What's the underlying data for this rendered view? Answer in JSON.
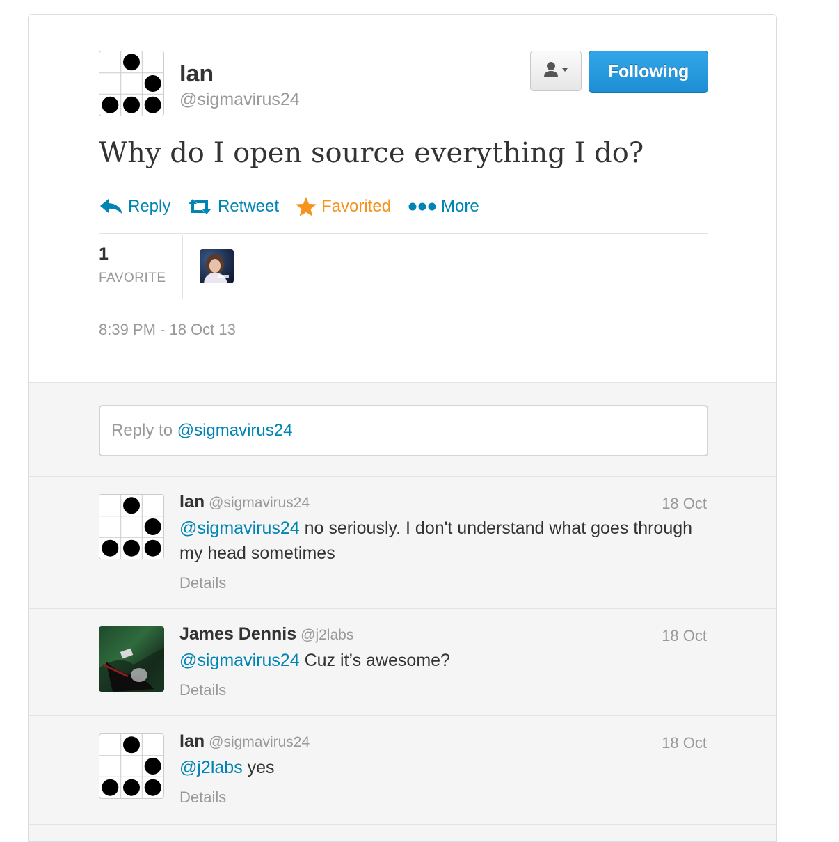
{
  "tweet": {
    "author_name": "Ian",
    "author_handle": "@sigmavirus24",
    "follow_label": "Following",
    "text": "Why do I open source everything I do?",
    "actions": {
      "reply": "Reply",
      "retweet": "Retweet",
      "favorited": "Favorited",
      "more": "More"
    },
    "stats": {
      "count": "1",
      "label": "FAVORITE"
    },
    "timestamp": "8:39 PM - 18 Oct 13"
  },
  "reply_box": {
    "prefix": "Reply to ",
    "mention": "@sigmavirus24"
  },
  "replies": [
    {
      "name": "Ian",
      "handle": "@sigmavirus24",
      "time": "18 Oct",
      "mention": "@sigmavirus24",
      "text": " no seriously. I don't understand what goes through my head sometimes",
      "details": "Details"
    },
    {
      "name": "James Dennis",
      "handle": "@j2labs",
      "time": "18 Oct",
      "mention": "@sigmavirus24",
      "text": " Cuz it’s awesome?",
      "details": "Details"
    },
    {
      "name": "Ian",
      "handle": "@sigmavirus24",
      "time": "18 Oct",
      "mention": "@j2labs",
      "text": " yes",
      "details": "Details"
    }
  ],
  "colors": {
    "link": "#0084b4",
    "favorite": "#f6931e",
    "follow_button": "#1d8ed3",
    "muted": "#999999"
  },
  "icons": [
    "reply-icon",
    "retweet-icon",
    "star-icon",
    "more-dots-icon",
    "user-menu-icon",
    "glider-avatar"
  ]
}
